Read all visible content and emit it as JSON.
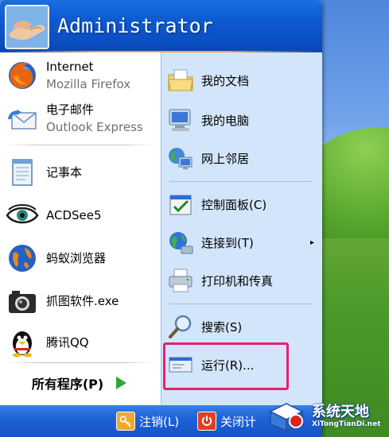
{
  "header": {
    "username": "Administrator"
  },
  "left_pane": {
    "pinned": [
      {
        "label": "Internet",
        "sublabel": "Mozilla Firefox",
        "icon": "firefox-icon"
      },
      {
        "label": "电子邮件",
        "sublabel": "Outlook Express",
        "icon": "outlook-express-icon"
      }
    ],
    "recent": [
      {
        "label": "记事本",
        "icon": "notepad-icon"
      },
      {
        "label": "ACDSee5",
        "icon": "acdsee-eye-icon"
      },
      {
        "label": "蚂蚁浏览器",
        "icon": "globe-browser-icon"
      },
      {
        "label": "抓图软件.exe",
        "icon": "camera-icon"
      },
      {
        "label": "腾讯QQ",
        "icon": "qq-penguin-icon"
      }
    ],
    "all_programs_label": "所有程序(P)"
  },
  "right_pane": {
    "items": [
      {
        "label": "我的文档",
        "icon": "my-documents-icon"
      },
      {
        "label": "我的电脑",
        "icon": "my-computer-icon"
      },
      {
        "label": "网上邻居",
        "icon": "network-places-icon"
      },
      {
        "label": "控制面板(C)",
        "icon": "control-panel-icon"
      },
      {
        "label": "连接到(T)",
        "icon": "connect-to-icon",
        "submenu": "▸"
      },
      {
        "label": "打印机和传真",
        "icon": "printer-icon"
      },
      {
        "label": "搜索(S)",
        "icon": "search-icon"
      },
      {
        "label": "运行(R)...",
        "icon": "run-icon"
      }
    ]
  },
  "footer": {
    "logoff_label": "注销(L)",
    "shutdown_label": "关闭计"
  },
  "watermark": {
    "title": "系统天地",
    "url": "XiTongTianDi.net"
  },
  "colors": {
    "header_blue": "#0b4fc4",
    "right_pane_bg": "#d3e5fa",
    "highlight_border": "#e3226e",
    "footer_blue": "#1d63d6",
    "accent_orange": "#f9a23a"
  }
}
